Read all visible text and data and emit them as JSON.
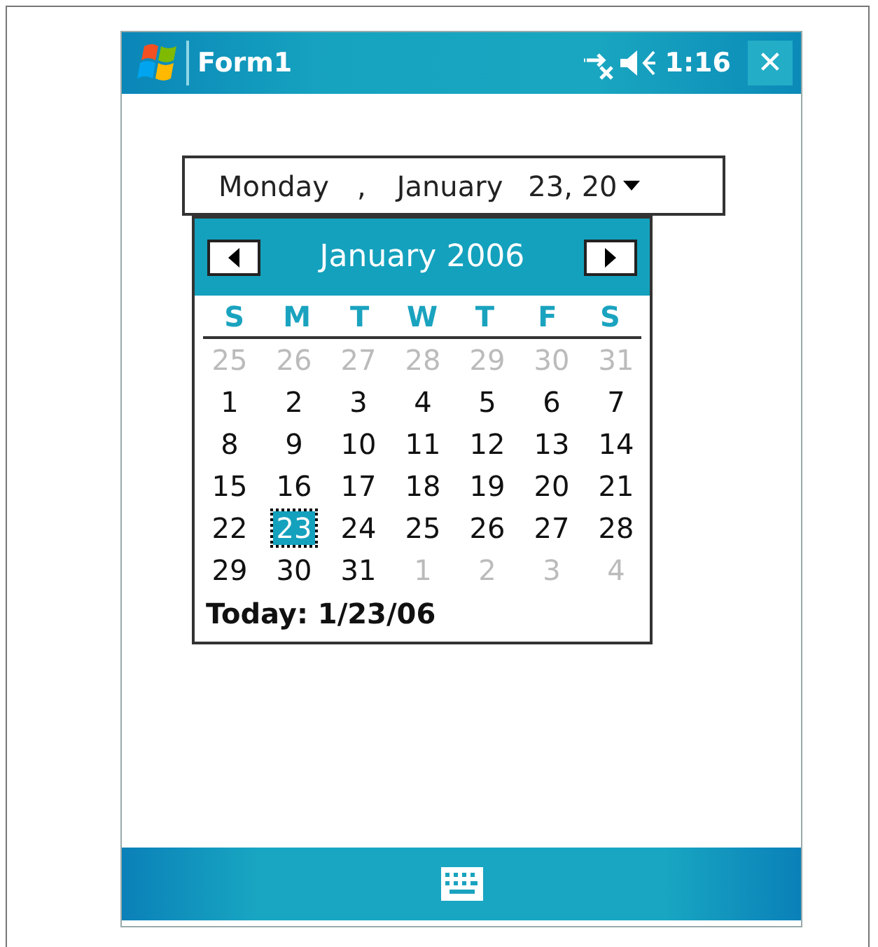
{
  "window": {
    "title": "Form1",
    "time": "1:16",
    "close": "✕"
  },
  "date_field": {
    "parts": [
      "Monday",
      ",",
      "January",
      "23, 20"
    ]
  },
  "calendar": {
    "month": "January 2006",
    "weekdays": [
      "S",
      "M",
      "T",
      "W",
      "T",
      "F",
      "S"
    ],
    "weeks": [
      [
        {
          "day": "25",
          "in_month": false,
          "selected": false
        },
        {
          "day": "26",
          "in_month": false,
          "selected": false
        },
        {
          "day": "27",
          "in_month": false,
          "selected": false
        },
        {
          "day": "28",
          "in_month": false,
          "selected": false
        },
        {
          "day": "29",
          "in_month": false,
          "selected": false
        },
        {
          "day": "30",
          "in_month": false,
          "selected": false
        },
        {
          "day": "31",
          "in_month": false,
          "selected": false
        }
      ],
      [
        {
          "day": "1",
          "in_month": true,
          "selected": false
        },
        {
          "day": "2",
          "in_month": true,
          "selected": false
        },
        {
          "day": "3",
          "in_month": true,
          "selected": false
        },
        {
          "day": "4",
          "in_month": true,
          "selected": false
        },
        {
          "day": "5",
          "in_month": true,
          "selected": false
        },
        {
          "day": "6",
          "in_month": true,
          "selected": false
        },
        {
          "day": "7",
          "in_month": true,
          "selected": false
        }
      ],
      [
        {
          "day": "8",
          "in_month": true,
          "selected": false
        },
        {
          "day": "9",
          "in_month": true,
          "selected": false
        },
        {
          "day": "10",
          "in_month": true,
          "selected": false
        },
        {
          "day": "11",
          "in_month": true,
          "selected": false
        },
        {
          "day": "12",
          "in_month": true,
          "selected": false
        },
        {
          "day": "13",
          "in_month": true,
          "selected": false
        },
        {
          "day": "14",
          "in_month": true,
          "selected": false
        }
      ],
      [
        {
          "day": "15",
          "in_month": true,
          "selected": false
        },
        {
          "day": "16",
          "in_month": true,
          "selected": false
        },
        {
          "day": "17",
          "in_month": true,
          "selected": false
        },
        {
          "day": "18",
          "in_month": true,
          "selected": false
        },
        {
          "day": "19",
          "in_month": true,
          "selected": false
        },
        {
          "day": "20",
          "in_month": true,
          "selected": false
        },
        {
          "day": "21",
          "in_month": true,
          "selected": false
        }
      ],
      [
        {
          "day": "22",
          "in_month": true,
          "selected": false
        },
        {
          "day": "23",
          "in_month": true,
          "selected": true
        },
        {
          "day": "24",
          "in_month": true,
          "selected": false
        },
        {
          "day": "25",
          "in_month": true,
          "selected": false
        },
        {
          "day": "26",
          "in_month": true,
          "selected": false
        },
        {
          "day": "27",
          "in_month": true,
          "selected": false
        },
        {
          "day": "28",
          "in_month": true,
          "selected": false
        }
      ],
      [
        {
          "day": "29",
          "in_month": true,
          "selected": false
        },
        {
          "day": "30",
          "in_month": true,
          "selected": false
        },
        {
          "day": "31",
          "in_month": true,
          "selected": false
        },
        {
          "day": "1",
          "in_month": false,
          "selected": false
        },
        {
          "day": "2",
          "in_month": false,
          "selected": false
        },
        {
          "day": "3",
          "in_month": false,
          "selected": false
        },
        {
          "day": "4",
          "in_month": false,
          "selected": false
        }
      ]
    ],
    "today": "Today: 1/23/06"
  }
}
